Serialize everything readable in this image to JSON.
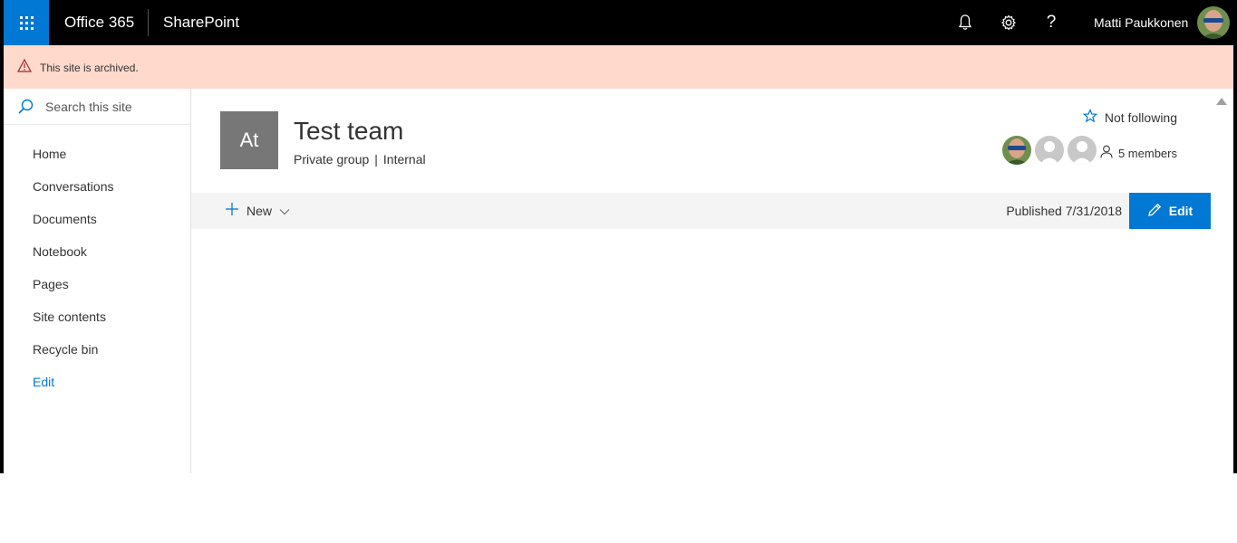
{
  "suite": {
    "app_launcher_icon": "waffle-icon",
    "brand": "Office 365",
    "app_name": "SharePoint",
    "icons": [
      "bell-icon",
      "gear-icon",
      "help-icon"
    ],
    "user_name": "Matti Paukkonen",
    "accent": "#0078d4"
  },
  "banner": {
    "icon": "warning-icon",
    "message": "This site is archived.",
    "background": "#fed9cc"
  },
  "search": {
    "placeholder": "Search this site"
  },
  "nav": {
    "items": [
      {
        "label": "Home"
      },
      {
        "label": "Conversations"
      },
      {
        "label": "Documents"
      },
      {
        "label": "Notebook"
      },
      {
        "label": "Pages"
      },
      {
        "label": "Site contents"
      },
      {
        "label": "Recycle bin"
      },
      {
        "label": "Edit"
      }
    ]
  },
  "site": {
    "logo_text": "At",
    "title": "Test team",
    "privacy": "Private group",
    "classification": "Internal",
    "follow_label": "Not following",
    "members_label": "5 members"
  },
  "command_bar": {
    "new_label": "New",
    "published": "Published 7/31/2018",
    "edit_label": "Edit"
  }
}
